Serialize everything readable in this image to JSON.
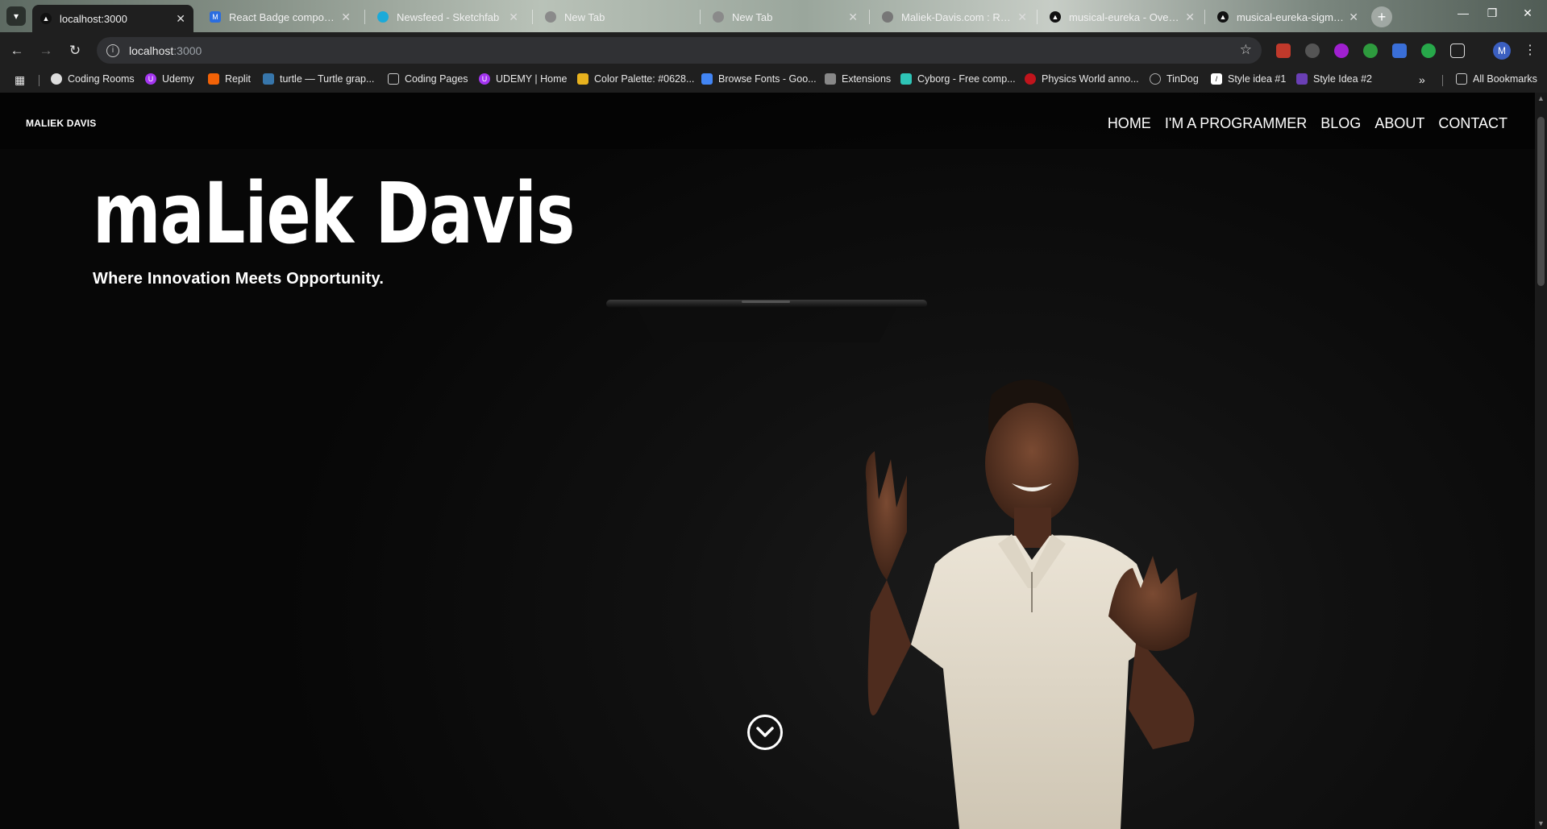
{
  "browser": {
    "tabs": [
      {
        "title": "localhost:3000",
        "active": true,
        "favicon": "triangle-icon"
      },
      {
        "title": "React Badge component",
        "active": false,
        "favicon": "mui-icon"
      },
      {
        "title": "Newsfeed - Sketchfab",
        "active": false,
        "favicon": "sketchfab-icon"
      },
      {
        "title": "New Tab",
        "active": false,
        "favicon": "chrome-icon"
      },
      {
        "title": "New Tab",
        "active": false,
        "favicon": "chrome-icon"
      },
      {
        "title": "Maliek-Davis.com : Rebra",
        "active": false,
        "favicon": "openai-icon"
      },
      {
        "title": "musical-eureka - Overvie",
        "active": false,
        "favicon": "triangle-icon"
      },
      {
        "title": "musical-eureka-sigma.ve",
        "active": false,
        "favicon": "triangle-icon"
      }
    ],
    "address": {
      "host": "localhost",
      "port": ":3000"
    },
    "profile_initial": "M",
    "bookmarks": [
      {
        "label": "Coding Rooms",
        "icon": "coding-rooms-icon"
      },
      {
        "label": "Udemy",
        "icon": "udemy-icon"
      },
      {
        "label": "Replit",
        "icon": "replit-icon"
      },
      {
        "label": "turtle — Turtle grap...",
        "icon": "python-icon"
      },
      {
        "label": "Coding Pages",
        "icon": "folder-icon"
      },
      {
        "label": "UDEMY | Home",
        "icon": "udemy-icon"
      },
      {
        "label": "Color Palette: #0628...",
        "icon": "palette-icon"
      },
      {
        "label": "Browse Fonts - Goo...",
        "icon": "google-fonts-icon"
      },
      {
        "label": "Extensions",
        "icon": "puzzle-icon"
      },
      {
        "label": "Cyborg - Free comp...",
        "icon": "cyborg-icon"
      },
      {
        "label": "Physics World anno...",
        "icon": "physics-icon"
      },
      {
        "label": "TinDog",
        "icon": "globe-icon"
      },
      {
        "label": "Style idea #1",
        "icon": "style-icon"
      },
      {
        "label": "Style Idea #2",
        "icon": "style-icon"
      }
    ],
    "all_bookmarks_label": "All Bookmarks"
  },
  "site": {
    "logo": "MALIEK DAVIS",
    "nav": [
      "HOME",
      "I'M A PROGRAMMER",
      "BLOG",
      "ABOUT",
      "CONTACT"
    ],
    "hero_title": "maLiek Davis",
    "hero_subtitle": "Where Innovation Meets Opportunity."
  }
}
